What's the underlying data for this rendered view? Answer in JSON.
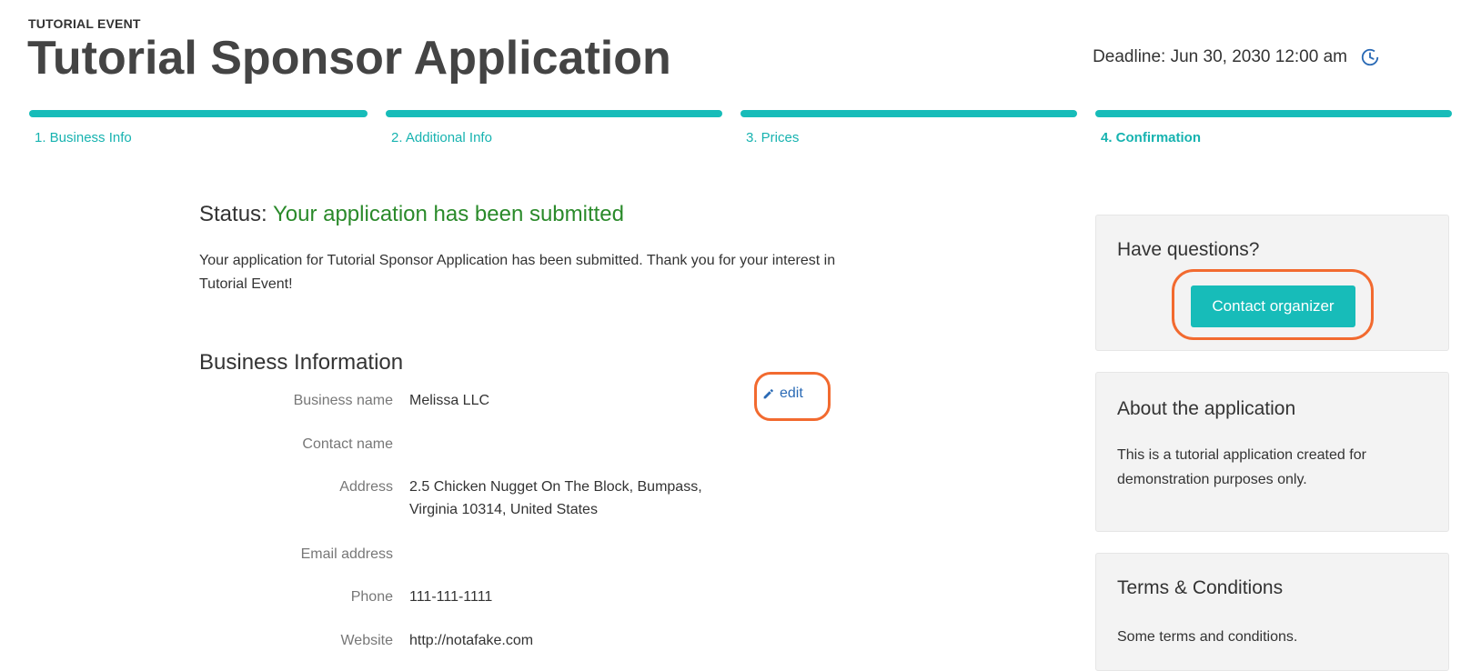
{
  "header": {
    "event_label": "TUTORIAL EVENT",
    "title": "Tutorial Sponsor Application",
    "deadline": "Deadline: Jun 30, 2030 12:00 am",
    "deadline_icon": "clock-icon"
  },
  "steps": [
    {
      "label": "1. Business Info",
      "active": false
    },
    {
      "label": "2. Additional Info",
      "active": false
    },
    {
      "label": "3. Prices",
      "active": false
    },
    {
      "label": "4. Confirmation",
      "active": true
    }
  ],
  "status": {
    "label": "Status:",
    "value": "Your application has been submitted",
    "message": "Your application for Tutorial Sponsor Application has been submitted. Thank you for your interest in Tutorial Event!"
  },
  "business": {
    "title": "Business Information",
    "edit_label": "edit",
    "rows": [
      {
        "label": "Business name",
        "value": "Melissa LLC"
      },
      {
        "label": "Contact name",
        "value": ""
      },
      {
        "label": "Address",
        "value": "2.5 Chicken Nugget On The Block, Bumpass, Virginia 10314, United States"
      },
      {
        "label": "Email address",
        "value": ""
      },
      {
        "label": "Phone",
        "value": "111-111-1111"
      },
      {
        "label": "Website",
        "value": "http://notafake.com"
      }
    ]
  },
  "sidebar": {
    "questions_title": "Have questions?",
    "contact_button": "Contact organizer",
    "about_title": "About the application",
    "about_text": "This is a tutorial application created for demonstration purposes only.",
    "terms_title": "Terms & Conditions",
    "terms_text": "Some terms and conditions."
  },
  "colors": {
    "accent": "#17bcb9",
    "status_green": "#2a8a2a",
    "link": "#2a6ab5",
    "highlight": "#f26a2f"
  }
}
